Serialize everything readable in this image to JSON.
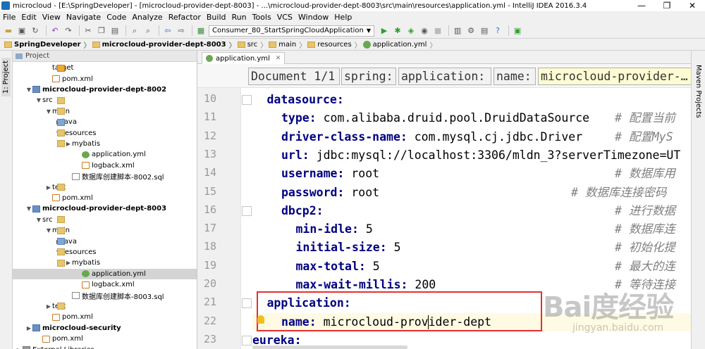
{
  "window": {
    "title": "microcloud - [E:\\SpringDeveloper] - [microcloud-provider-dept-8003] - ...\\microcloud-provider-dept-8003\\src\\main\\resources\\application.yml - IntelliJ IDEA 2016.3.4",
    "controls": [
      "—",
      "❐",
      "✕"
    ]
  },
  "menu": [
    "File",
    "Edit",
    "View",
    "Navigate",
    "Code",
    "Analyze",
    "Refactor",
    "Build",
    "Run",
    "Tools",
    "VCS",
    "Window",
    "Help"
  ],
  "toolbar": {
    "run_config": "Consumer_80_StartSpringCloudApplication"
  },
  "breadcrumbs": [
    {
      "label": "SpringDeveloper",
      "bold": true,
      "icon": "folder-icon"
    },
    {
      "label": "microcloud-provider-dept-8003",
      "bold": true,
      "icon": "folder-icon"
    },
    {
      "label": "src",
      "bold": false,
      "icon": "folder-icon"
    },
    {
      "label": "main",
      "bold": false,
      "icon": "folder-icon"
    },
    {
      "label": "resources",
      "bold": false,
      "icon": "folder-icon"
    },
    {
      "label": "application.yml",
      "bold": false,
      "icon": "yml-icon"
    }
  ],
  "left_tool": "1: Project",
  "right_tool": "Maven Projects",
  "project_panel": {
    "title": "Project",
    "tree": [
      {
        "label": "target",
        "indent": 3,
        "icon": "folder-orange",
        "arrow": "",
        "bold": false,
        "selected": false
      },
      {
        "label": "pom.xml",
        "indent": 3,
        "icon": "xml",
        "arrow": "",
        "bold": false,
        "selected": false
      },
      {
        "label": "microcloud-provider-dept-8002",
        "indent": 1,
        "icon": "mod",
        "arrow": "▼",
        "bold": true,
        "selected": false
      },
      {
        "label": "src",
        "indent": 2,
        "icon": "folder",
        "arrow": "▼",
        "bold": false,
        "selected": false
      },
      {
        "label": "main",
        "indent": 3,
        "icon": "folder",
        "arrow": "▼",
        "bold": false,
        "selected": false
      },
      {
        "label": "java",
        "indent": 4,
        "icon": "folder-blue",
        "arrow": "▶",
        "bold": false,
        "selected": false
      },
      {
        "label": "resources",
        "indent": 4,
        "icon": "folder",
        "arrow": "▼",
        "bold": false,
        "selected": false
      },
      {
        "label": "mybatis",
        "indent": 5,
        "icon": "folder",
        "arrow": "▶",
        "bold": false,
        "selected": false
      },
      {
        "label": "application.yml",
        "indent": 6,
        "icon": "yml",
        "arrow": "",
        "bold": false,
        "selected": false
      },
      {
        "label": "logback.xml",
        "indent": 6,
        "icon": "xml",
        "arrow": "",
        "bold": false,
        "selected": false
      },
      {
        "label": "数据库创建脚本-8002.sql",
        "indent": 5,
        "icon": "sql",
        "arrow": "",
        "bold": false,
        "selected": false
      },
      {
        "label": "test",
        "indent": 3,
        "icon": "folder",
        "arrow": "▶",
        "bold": false,
        "selected": false
      },
      {
        "label": "pom.xml",
        "indent": 3,
        "icon": "xml",
        "arrow": "",
        "bold": false,
        "selected": false
      },
      {
        "label": "microcloud-provider-dept-8003",
        "indent": 1,
        "icon": "mod",
        "arrow": "▼",
        "bold": true,
        "selected": false
      },
      {
        "label": "src",
        "indent": 2,
        "icon": "folder",
        "arrow": "▼",
        "bold": false,
        "selected": false
      },
      {
        "label": "main",
        "indent": 3,
        "icon": "folder",
        "arrow": "▼",
        "bold": false,
        "selected": false
      },
      {
        "label": "java",
        "indent": 4,
        "icon": "folder-blue",
        "arrow": "▶",
        "bold": false,
        "selected": false
      },
      {
        "label": "resources",
        "indent": 4,
        "icon": "folder",
        "arrow": "▼",
        "bold": false,
        "selected": false
      },
      {
        "label": "mybatis",
        "indent": 5,
        "icon": "folder",
        "arrow": "▶",
        "bold": false,
        "selected": false
      },
      {
        "label": "application.yml",
        "indent": 6,
        "icon": "yml",
        "arrow": "",
        "bold": false,
        "selected": true
      },
      {
        "label": "logback.xml",
        "indent": 6,
        "icon": "xml",
        "arrow": "",
        "bold": false,
        "selected": false
      },
      {
        "label": "数据库创建脚本-8003.sql",
        "indent": 5,
        "icon": "sql",
        "arrow": "",
        "bold": false,
        "selected": false
      },
      {
        "label": "test",
        "indent": 3,
        "icon": "folder",
        "arrow": "▶",
        "bold": false,
        "selected": false
      },
      {
        "label": "pom.xml",
        "indent": 3,
        "icon": "xml",
        "arrow": "",
        "bold": false,
        "selected": false
      },
      {
        "label": "microcloud-security",
        "indent": 1,
        "icon": "mod",
        "arrow": "▶",
        "bold": true,
        "selected": false
      },
      {
        "label": "pom.xml",
        "indent": 2,
        "icon": "xml",
        "arrow": "",
        "bold": false,
        "selected": false
      },
      {
        "label": "External Libraries",
        "indent": 0,
        "icon": "lib",
        "arrow": "▶",
        "bold": false,
        "selected": false
      }
    ]
  },
  "editor_tab": "application.yml",
  "yaml_path": [
    "Document 1/1",
    "spring:",
    "application:",
    "name:",
    "microcloud-provider-…"
  ],
  "code_lines": [
    {
      "n": "10",
      "indent": 1,
      "key": "datasource:",
      "val": "",
      "comment": ""
    },
    {
      "n": "11",
      "indent": 2,
      "key": "type:",
      "val": "com.alibaba.druid.pool.DruidDataSource",
      "comment": "# 配置当前"
    },
    {
      "n": "12",
      "indent": 2,
      "key": "driver-class-name:",
      "val": "com.mysql.cj.jdbc.Driver",
      "comment": "# 配置MyS"
    },
    {
      "n": "13",
      "indent": 2,
      "key": "url:",
      "val": "jdbc:mysql://localhost:3306/mldn_3?serverTimezone=UT",
      "comment": ""
    },
    {
      "n": "14",
      "indent": 2,
      "key": "username:",
      "val": "root",
      "comment": "# 数据库用"
    },
    {
      "n": "15",
      "indent": 2,
      "key": "password:",
      "val": "root",
      "comment": "# 数据库连接密码"
    },
    {
      "n": "16",
      "indent": 2,
      "key": "dbcp2:",
      "val": "",
      "comment": "# 进行数据"
    },
    {
      "n": "17",
      "indent": 3,
      "key": "min-idle:",
      "val": "5",
      "comment": "# 数据库连"
    },
    {
      "n": "18",
      "indent": 3,
      "key": "initial-size:",
      "val": "5",
      "comment": "# 初始化提"
    },
    {
      "n": "19",
      "indent": 3,
      "key": "max-total:",
      "val": "5",
      "comment": "# 最大的连"
    },
    {
      "n": "20",
      "indent": 3,
      "key": "max-wait-millis:",
      "val": "200",
      "comment": "# 等待连接"
    },
    {
      "n": "21",
      "indent": 1,
      "key": "application:",
      "val": "",
      "comment": ""
    },
    {
      "n": "22",
      "indent": 2,
      "key": "name:",
      "val": "microcloud-provider-dept",
      "comment": ""
    },
    {
      "n": "23",
      "indent": 0,
      "key": "eureka:",
      "val": "",
      "comment": ""
    }
  ],
  "watermark": {
    "big": "Bai度经验",
    "small": "jingyan.baidu.com"
  }
}
